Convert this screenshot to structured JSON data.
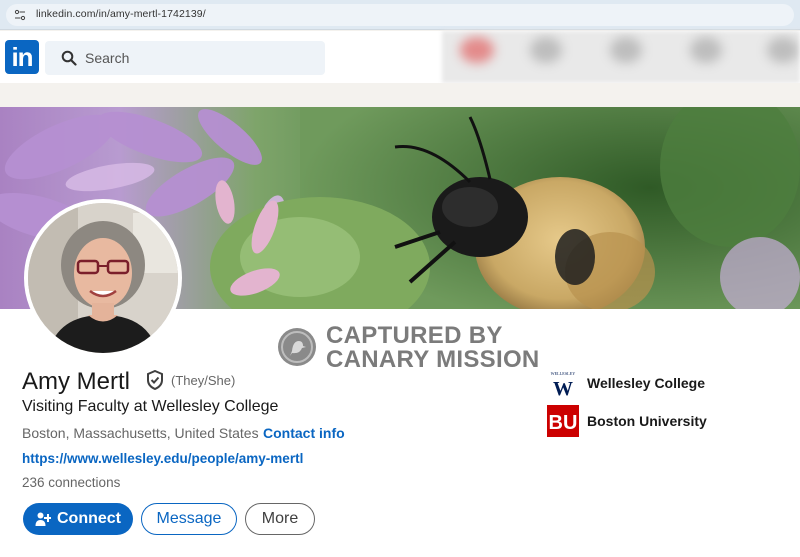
{
  "browser": {
    "url": "linkedin.com/in/amy-mertl-1742139/"
  },
  "nav": {
    "logo_text": "in",
    "search_placeholder": "Search"
  },
  "watermark": {
    "line1": "CAPTURED BY",
    "line2": "CANARY MISSION"
  },
  "profile": {
    "name": "Amy Mertl",
    "pronouns": "(They/She)",
    "headline": "Visiting Faculty at Wellesley College",
    "location": "Boston, Massachusetts, United States",
    "separator": "·",
    "contact_label": "Contact info",
    "website": "https://www.wellesley.edu/people/amy-mertl",
    "connections": "236 connections"
  },
  "actions": {
    "connect": "Connect",
    "message": "Message",
    "more": "More"
  },
  "education": [
    {
      "name": "Wellesley College",
      "logo_text": "WELLESLEY",
      "logo_letter": "W"
    },
    {
      "name": "Boston University",
      "logo_text": "BU"
    }
  ],
  "colors": {
    "brand": "#0a66c2",
    "bu_red": "#cc0000",
    "wellesley_blue": "#001c54"
  }
}
